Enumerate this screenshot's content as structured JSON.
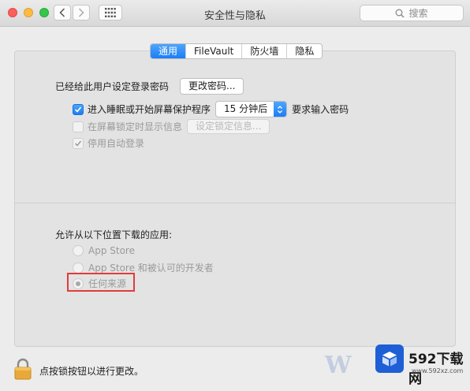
{
  "window": {
    "title": "安全性与隐私"
  },
  "toolbar": {
    "search_placeholder": "搜索"
  },
  "tabs": [
    {
      "label": "通用",
      "active": true
    },
    {
      "label": "FileVault",
      "active": false
    },
    {
      "label": "防火墙",
      "active": false
    },
    {
      "label": "隐私",
      "active": false
    }
  ],
  "general": {
    "password_label": "已经给此用户设定登录密码",
    "change_password_button": "更改密码...",
    "require_password": {
      "label": "进入睡眠或开始屏幕保护程序",
      "checked": true
    },
    "require_password_delay": "15 分钟后",
    "require_password_suffix": "要求输入密码",
    "show_message": {
      "label": "在屏幕锁定时显示信息",
      "checked": false,
      "disabled": true
    },
    "set_lock_message_button": "设定锁定信息...",
    "disable_auto_login": {
      "label": "停用自动登录",
      "checked": true,
      "disabled": true
    }
  },
  "downloads": {
    "heading": "允许从以下位置下载的应用:",
    "options": [
      {
        "label": "App Store",
        "selected": false,
        "disabled": true
      },
      {
        "label": "App Store 和被认可的开发者",
        "selected": false,
        "disabled": true
      },
      {
        "label": "任何来源",
        "selected": true,
        "disabled": true
      }
    ]
  },
  "footer": {
    "lock_text": "点按锁按钮以进行更改。"
  },
  "watermark": {
    "title": "592下载网",
    "url": "www.592xz.com"
  },
  "colors": {
    "accent": "#1b7ef5",
    "highlight": "#e23b3b"
  }
}
